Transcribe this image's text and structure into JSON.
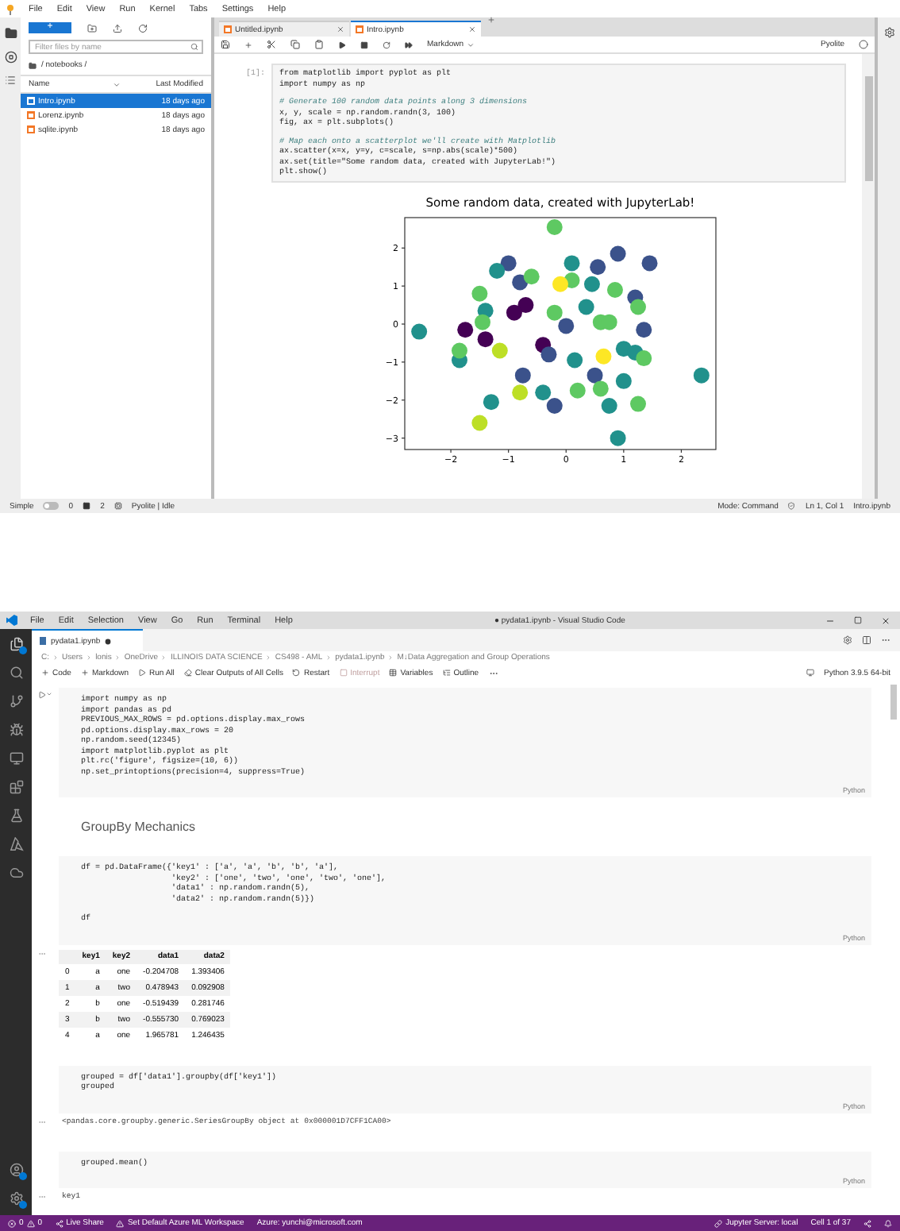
{
  "jupyterlab": {
    "menu": [
      "File",
      "Edit",
      "View",
      "Run",
      "Kernel",
      "Tabs",
      "Settings",
      "Help"
    ],
    "file_browser": {
      "new_label": "+",
      "filter": {
        "placeholder": "Filter files by name"
      },
      "path": "/ notebooks /",
      "columns": [
        "Name",
        "Last Modified"
      ],
      "files": [
        {
          "name": "Intro.ipynb",
          "modified": "18 days ago",
          "selected": true
        },
        {
          "name": "Lorenz.ipynb",
          "modified": "18 days ago",
          "selected": false
        },
        {
          "name": "sqlite.ipynb",
          "modified": "18 days ago",
          "selected": false
        }
      ]
    },
    "tabs": [
      {
        "label": "Untitled.ipynb",
        "selected": false
      },
      {
        "label": "Intro.ipynb",
        "selected": true
      }
    ],
    "toolbar": {
      "cell_type": "Markdown",
      "kernel": "Pyolite"
    },
    "cell": {
      "prompt": "[1]:",
      "blocks": [
        [
          {
            "text": "from matplotlib import pyplot as plt",
            "kind": "code"
          },
          {
            "text": "import numpy as np",
            "kind": "code"
          }
        ],
        [
          {
            "text": "# Generate 100 random data points along 3 dimensions",
            "kind": "comment"
          },
          {
            "text": "x, y, scale = np.random.randn(3, 100)",
            "kind": "code"
          },
          {
            "text": "fig, ax = plt.subplots()",
            "kind": "code"
          }
        ],
        [
          {
            "text": "# Map each onto a scatterplot we'll create with Matplotlib",
            "kind": "comment"
          },
          {
            "text": "ax.scatter(x=x, y=y, c=scale, s=np.abs(scale)*500)",
            "kind": "code"
          },
          {
            "text": "ax.set(title=\"Some random data, created with JupyterLab!\")",
            "kind": "code"
          },
          {
            "text": "plt.show()",
            "kind": "code"
          }
        ]
      ]
    },
    "chart_data": {
      "type": "scatter",
      "title": "Some random data, created with JupyterLab!",
      "xlim": [
        -2.8,
        2.6
      ],
      "ylim": [
        -3.3,
        2.8
      ],
      "xticks": [
        {
          "value": -2,
          "label": "−2"
        },
        {
          "value": -1,
          "label": "−1"
        },
        0,
        1,
        2
      ],
      "yticks": [
        {
          "value": -3,
          "label": "−3"
        },
        {
          "value": -2,
          "label": "−2"
        },
        {
          "value": -1,
          "label": "−1"
        },
        0,
        1,
        2
      ],
      "series": [
        {
          "color": "#440154",
          "x": [
            -1.75,
            -0.7,
            -0.9,
            -1.4,
            -0.4
          ],
          "values": [
            -0.15,
            0.5,
            0.3,
            -0.4,
            -0.55
          ]
        },
        {
          "color": "#3b528b",
          "x": [
            -1.0,
            0.9,
            1.45,
            0.55,
            1.2,
            -0.75,
            0.5,
            -0.2,
            -0.3,
            0.0,
            1.35,
            -0.8
          ],
          "values": [
            1.6,
            1.85,
            1.6,
            1.5,
            0.7,
            -1.35,
            -1.35,
            -2.15,
            -0.8,
            -0.05,
            -0.15,
            1.1
          ]
        },
        {
          "color": "#21918c",
          "x": [
            -2.55,
            -1.2,
            -1.4,
            0.1,
            0.45,
            -0.4,
            -1.3,
            0.75,
            0.9,
            1.0,
            2.35,
            0.15,
            1.0,
            -1.85,
            0.35,
            1.2
          ],
          "values": [
            -0.2,
            1.4,
            0.35,
            1.6,
            1.05,
            -1.8,
            -2.05,
            -2.15,
            -3.0,
            -1.5,
            -1.35,
            -0.95,
            -0.65,
            -0.95,
            0.45,
            -0.75
          ]
        },
        {
          "color": "#5ec962",
          "x": [
            -1.5,
            -0.6,
            0.1,
            0.85,
            1.25,
            -1.45,
            -0.2,
            0.6,
            -1.85,
            0.2,
            0.6,
            1.25,
            -0.2,
            1.35,
            0.75
          ],
          "values": [
            0.8,
            1.25,
            1.15,
            0.9,
            0.45,
            0.05,
            0.3,
            0.05,
            -0.7,
            -1.75,
            -1.7,
            -2.1,
            2.55,
            -0.9,
            0.05
          ]
        },
        {
          "color": "#bddf26",
          "x": [
            -1.15,
            -1.5,
            -0.8
          ],
          "values": [
            -0.7,
            -2.6,
            -1.8
          ]
        },
        {
          "color": "#fde725",
          "x": [
            -0.1,
            0.65
          ],
          "values": [
            1.05,
            -0.85
          ]
        }
      ]
    },
    "status_bar": {
      "mode_switch": {
        "label": "Simple",
        "on": false
      },
      "terminals": "0",
      "kernels": "2",
      "kernel_status": "Pyolite | Idle",
      "mode": "Mode: Command",
      "position": "Ln 1, Col 1",
      "file": "Intro.ipynb"
    }
  },
  "vscode": {
    "menu": [
      "File",
      "Edit",
      "Selection",
      "View",
      "Go",
      "Run",
      "Terminal",
      "Help"
    ],
    "title": "● pydata1.ipynb - Visual Studio Code",
    "tab": {
      "label": "pydata1.ipynb",
      "dirty": true
    },
    "breadcrumb": [
      "C:",
      "Users",
      "lonis",
      "OneDrive",
      "ILLINOIS DATA SCIENCE",
      "CS498 - AML",
      "pydata1.ipynb",
      "M↓Data Aggregation and Group Operations"
    ],
    "toolbar": [
      {
        "label": "Code",
        "kind": "plus",
        "disabled": false
      },
      {
        "label": "Markdown",
        "kind": "plus",
        "disabled": false
      },
      {
        "label": "Run All",
        "kind": "run",
        "disabled": false
      },
      {
        "label": "Clear Outputs of All Cells",
        "kind": "clear",
        "disabled": false
      },
      {
        "label": "Restart",
        "kind": "restart",
        "disabled": false
      },
      {
        "label": "Interrupt",
        "kind": "stop",
        "disabled": true
      },
      {
        "label": "Variables",
        "kind": "variables",
        "disabled": false
      },
      {
        "label": "Outline",
        "kind": "outline",
        "disabled": false
      }
    ],
    "kernel": "Python 3.9.5 64-bit",
    "cells": [
      {
        "kind": "code",
        "language": "Python",
        "blocks": [
          [
            {
              "text": "import numpy as np",
              "kind": "code"
            },
            {
              "text": "import pandas as pd",
              "kind": "code"
            },
            {
              "text": "PREVIOUS_MAX_ROWS = pd.options.display.max_rows",
              "kind": "code"
            },
            {
              "text": "pd.options.display.max_rows = 20",
              "kind": "code"
            },
            {
              "text": "np.random.seed(12345)",
              "kind": "code"
            },
            {
              "text": "import matplotlib.pyplot as plt",
              "kind": "code"
            },
            {
              "text": "plt.rc('figure', figsize=(10, 6))",
              "kind": "code"
            },
            {
              "text": "np.set_printoptions(precision=4, suppress=True)",
              "kind": "code"
            }
          ]
        ]
      },
      {
        "kind": "markdown",
        "text": "GroupBy Mechanics"
      },
      {
        "kind": "code",
        "language": "Python",
        "blocks": [
          [
            {
              "text": "df = pd.DataFrame({'key1' : ['a', 'a', 'b', 'b', 'a'],",
              "kind": "code"
            },
            {
              "text": "                   'key2' : ['one', 'two', 'one', 'two', 'one'],",
              "kind": "code"
            },
            {
              "text": "                   'data1' : np.random.randn(5),",
              "kind": "code"
            },
            {
              "text": "                   'data2' : np.random.randn(5)})",
              "kind": "code"
            }
          ],
          [
            {
              "text": "df",
              "kind": "code"
            }
          ]
        ],
        "output": {
          "kind": "table",
          "columns": [
            "key1",
            "key2",
            "data1",
            "data2"
          ],
          "rows": [
            {
              "index": "0",
              "cells": [
                "a",
                "one",
                "-0.204708",
                "1.393406"
              ]
            },
            {
              "index": "1",
              "cells": [
                "a",
                "two",
                "0.478943",
                "0.092908"
              ]
            },
            {
              "index": "2",
              "cells": [
                "b",
                "one",
                "-0.519439",
                "0.281746"
              ]
            },
            {
              "index": "3",
              "cells": [
                "b",
                "two",
                "-0.555730",
                "0.769023"
              ]
            },
            {
              "index": "4",
              "cells": [
                "a",
                "one",
                "1.965781",
                "1.246435"
              ]
            }
          ]
        }
      },
      {
        "kind": "code",
        "language": "Python",
        "blocks": [
          [
            {
              "text": "grouped = df['data1'].groupby(df['key1'])",
              "kind": "code"
            },
            {
              "text": "grouped",
              "kind": "code"
            }
          ]
        ],
        "output": {
          "kind": "text",
          "text": "<pandas.core.groupby.generic.SeriesGroupBy object at 0x000001D7CFF1CA00>"
        }
      },
      {
        "kind": "code",
        "language": "Python",
        "blocks": [
          [
            {
              "text": "grouped.mean()",
              "kind": "code"
            }
          ]
        ],
        "output": {
          "kind": "text",
          "text": "key1"
        }
      }
    ],
    "status_bar": {
      "errors": "0",
      "warnings": "0",
      "left": [
        "Live Share",
        "Set Default Azure ML Workspace",
        "Azure: yunchi@microsoft.com"
      ],
      "right": [
        "Jupyter Server: local",
        "Cell 1 of 37"
      ]
    }
  }
}
